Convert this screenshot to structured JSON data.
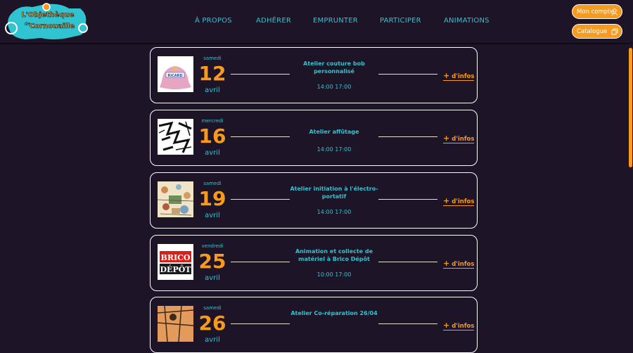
{
  "brand": {
    "line1": "L'Objethèque",
    "line2": "de",
    "line3": "Cornouaille"
  },
  "nav": [
    {
      "label": "À PROPOS"
    },
    {
      "label": "ADHÉRER"
    },
    {
      "label": "EMPRUNTER"
    },
    {
      "label": "PARTICIPER"
    },
    {
      "label": "ANIMATIONS"
    }
  ],
  "account_button": {
    "label": "Mon compte",
    "icon": "user-icon"
  },
  "catalogue_button": {
    "label": "Catalogue",
    "icon": "copy-icon"
  },
  "colors": {
    "background": "#1e1428",
    "accent": "#f79a1e",
    "teal": "#2fc4cf"
  },
  "events": [
    {
      "weekday": "samedi",
      "day": "12",
      "month": "avril",
      "title": "Atelier couture bob personnalisé",
      "time": "14:00 17:00",
      "more_label": "d'infos",
      "plus": "+",
      "thumb_text": "RICARD"
    },
    {
      "weekday": "mercredi",
      "day": "16",
      "month": "avril",
      "title": "Atelier affûtage",
      "time": "14:00 17:00",
      "more_label": "d'infos",
      "plus": "+"
    },
    {
      "weekday": "samedi",
      "day": "19",
      "month": "avril",
      "title": "Atelier initiation à l'électro-portatif",
      "time": "14:00 17:00",
      "more_label": "d'infos",
      "plus": "+"
    },
    {
      "weekday": "vendredi",
      "day": "25",
      "month": "avril",
      "title": "Animation et collecte de matériel à Brico Dépôt",
      "time": "10:00 17:00",
      "more_label": "d'infos",
      "plus": "+",
      "thumb_text": [
        "BRICO",
        "DÉPÔT"
      ]
    },
    {
      "weekday": "samedi",
      "day": "26",
      "month": "avril",
      "title": "Atelier Co-réparation 26/04",
      "time": "",
      "more_label": "d'infos",
      "plus": "+"
    }
  ]
}
